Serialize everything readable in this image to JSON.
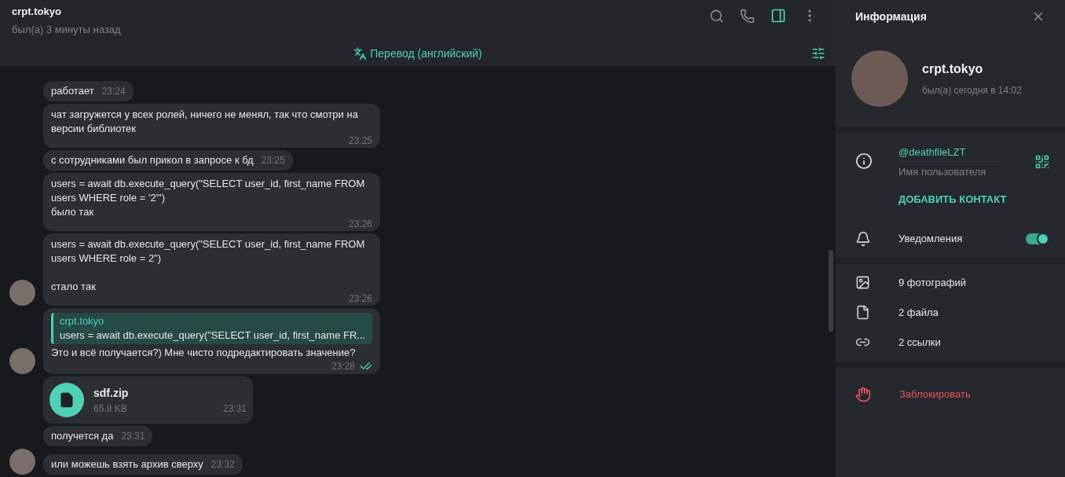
{
  "chat_header": {
    "title": "crpt.tokyo",
    "status": "был(а) 3 минуты назад"
  },
  "translate_bar": {
    "label": "Перевод (английский)"
  },
  "messages": [
    {
      "kind": "text",
      "text": "работает",
      "time": "23:24",
      "avatar": false,
      "read": false
    },
    {
      "kind": "text",
      "text": "чат загружется у всех ролей, ничего не менял, так что смотри на версии библиотек",
      "time": "23:25",
      "avatar": false,
      "read": false
    },
    {
      "kind": "text",
      "text": "с сотрудниками был прикол в запросе к бд",
      "time": "23:25",
      "avatar": false,
      "read": false
    },
    {
      "kind": "text",
      "text": "users = await db.execute_query(\"SELECT user_id, first_name FROM users WHERE role = '2'\")\nбыло так",
      "time": "23:26",
      "avatar": false,
      "read": false
    },
    {
      "kind": "text",
      "text": "users = await db.execute_query(\"SELECT user_id, first_name FROM users WHERE role = 2\")\n\nстало так",
      "time": "23:26",
      "avatar": true,
      "read": false
    },
    {
      "kind": "reply",
      "reply_author": "crpt.tokyo",
      "reply_text": "users = await db.execute_query(\"SELECT user_id, first_name FR...",
      "text": "Это и всё получается?) Мне чисто подредактировать значение?",
      "time": "23:28",
      "avatar": true,
      "read": true
    },
    {
      "kind": "file",
      "file_name": "sdf.zip",
      "file_size": "65.8 KB",
      "time": "23:31",
      "avatar": false,
      "read": false
    },
    {
      "kind": "text",
      "text": "получется да",
      "time": "23:31",
      "avatar": false,
      "read": false
    },
    {
      "kind": "text",
      "text": "или можешь взять архив сверху",
      "time": "23:32",
      "avatar": true,
      "read": false
    }
  ],
  "info_panel": {
    "title": "Информация",
    "name": "crpt.tokyo",
    "status": "был(а) сегодня в 14:02",
    "username": "@deathfileLZT",
    "username_caption": "Имя пользователя",
    "add_contact": "ДОБАВИТЬ КОНТАКТ",
    "notifications": {
      "label": "Уведомления",
      "on": true
    },
    "media": [
      {
        "kind": "photos",
        "label": "9 фотографий"
      },
      {
        "kind": "files",
        "label": "2 файла"
      },
      {
        "kind": "links",
        "label": "2 ссылки"
      }
    ],
    "block": "Заблокировать"
  }
}
